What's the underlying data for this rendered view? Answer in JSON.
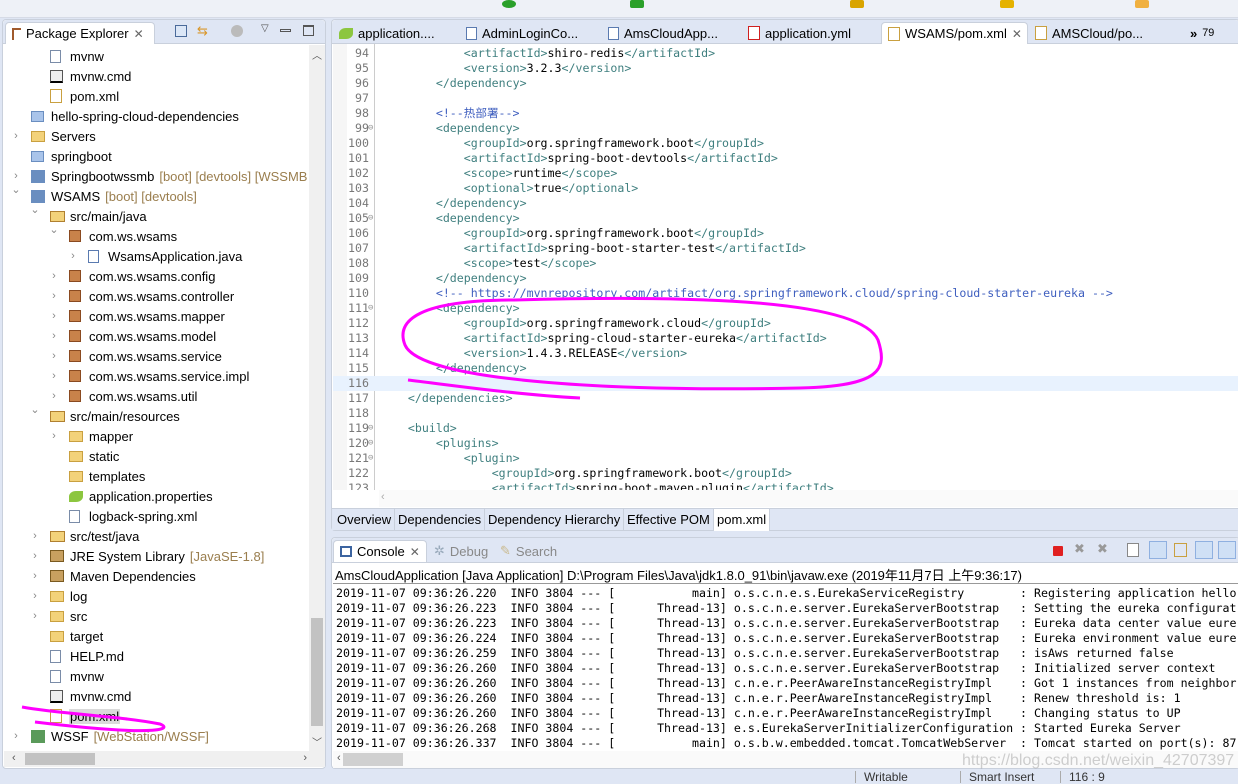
{
  "package_explorer": {
    "title": "Package Explorer",
    "tree": [
      {
        "level": 2,
        "label": "mvnw",
        "icon": "file-icon"
      },
      {
        "level": 2,
        "label": "mvnw.cmd",
        "icon": "cmd-file-icon"
      },
      {
        "level": 2,
        "label": "pom.xml",
        "icon": "maven-pom-icon"
      },
      {
        "level": 1,
        "label": "hello-spring-cloud-dependencies",
        "icon": "project-folder-icon"
      },
      {
        "level": 1,
        "label": "Servers",
        "icon": "folder-icon",
        "arrow": "closed"
      },
      {
        "level": 1,
        "label": "springboot",
        "icon": "project-folder-icon"
      },
      {
        "level": 1,
        "label": "Springbootwssmb",
        "decoration": "[boot] [devtools] [WSSMB",
        "icon": "spring-boot-project-icon",
        "arrow": "closed"
      },
      {
        "level": 1,
        "label": "WSAMS",
        "decoration": "[boot] [devtools]",
        "icon": "spring-boot-project-icon",
        "arrow": "open"
      },
      {
        "level": 2,
        "label": "src/main/java",
        "icon": "source-folder-icon",
        "arrow": "open"
      },
      {
        "level": 3,
        "label": "com.ws.wsams",
        "icon": "package-icon",
        "arrow": "open"
      },
      {
        "level": 4,
        "label": "WsamsApplication.java",
        "icon": "java-file-icon",
        "arrow": "closed"
      },
      {
        "level": 3,
        "label": "com.ws.wsams.config",
        "icon": "package-icon",
        "arrow": "closed"
      },
      {
        "level": 3,
        "label": "com.ws.wsams.controller",
        "icon": "package-icon",
        "arrow": "closed"
      },
      {
        "level": 3,
        "label": "com.ws.wsams.mapper",
        "icon": "package-icon",
        "arrow": "closed"
      },
      {
        "level": 3,
        "label": "com.ws.wsams.model",
        "icon": "package-icon",
        "arrow": "closed"
      },
      {
        "level": 3,
        "label": "com.ws.wsams.service",
        "icon": "package-icon",
        "arrow": "closed"
      },
      {
        "level": 3,
        "label": "com.ws.wsams.service.impl",
        "icon": "package-icon",
        "arrow": "closed"
      },
      {
        "level": 3,
        "label": "com.ws.wsams.util",
        "icon": "package-icon",
        "arrow": "closed"
      },
      {
        "level": 2,
        "label": "src/main/resources",
        "icon": "source-folder-icon",
        "arrow": "open"
      },
      {
        "level": 3,
        "label": "mapper",
        "icon": "folder-icon",
        "arrow": "closed"
      },
      {
        "level": 3,
        "label": "static",
        "icon": "folder-icon"
      },
      {
        "level": 3,
        "label": "templates",
        "icon": "folder-icon"
      },
      {
        "level": 3,
        "label": "application.properties",
        "icon": "spring-properties-icon"
      },
      {
        "level": 3,
        "label": "logback-spring.xml",
        "icon": "xml-file-icon"
      },
      {
        "level": 2,
        "label": "src/test/java",
        "icon": "source-folder-icon",
        "arrow": "closed"
      },
      {
        "level": 2,
        "label": "JRE System Library",
        "decoration": "[JavaSE-1.8]",
        "icon": "library-icon",
        "arrow": "closed"
      },
      {
        "level": 2,
        "label": "Maven Dependencies",
        "icon": "library-icon",
        "arrow": "closed"
      },
      {
        "level": 2,
        "label": "log",
        "icon": "folder-icon",
        "arrow": "closed"
      },
      {
        "level": 2,
        "label": "src",
        "icon": "folder-icon",
        "arrow": "closed"
      },
      {
        "level": 2,
        "label": "target",
        "icon": "folder-icon"
      },
      {
        "level": 2,
        "label": "HELP.md",
        "icon": "file-icon"
      },
      {
        "level": 2,
        "label": "mvnw",
        "icon": "file-icon"
      },
      {
        "level": 2,
        "label": "mvnw.cmd",
        "icon": "cmd-file-icon"
      },
      {
        "level": 2,
        "label": "pom.xml",
        "icon": "maven-pom-icon",
        "selected": true
      },
      {
        "level": 1,
        "label": "WSSF",
        "decoration": "[WebStation/WSSF]",
        "icon": "web-project-icon",
        "arrow": "closed"
      }
    ]
  },
  "editor": {
    "tabs": [
      {
        "label": "application....",
        "icon": "spring-properties-icon"
      },
      {
        "label": "AdminLoginCo...",
        "icon": "java-file-icon"
      },
      {
        "label": "AmsCloudApp...",
        "icon": "java-file-icon"
      },
      {
        "label": "application.yml",
        "icon": "yaml-file-icon"
      },
      {
        "label": "WSAMS/pom.xml",
        "icon": "maven-pom-icon",
        "active": true
      },
      {
        "label": "AMSCloud/po...",
        "icon": "maven-pom-icon"
      }
    ],
    "overflow_count": "79",
    "current_line": 116,
    "lines": [
      {
        "n": "94",
        "t": "            <artifactId>shiro-redis</artifactId>"
      },
      {
        "n": "95",
        "t": "            <version>3.2.3</version>"
      },
      {
        "n": "96",
        "t": "        </dependency>"
      },
      {
        "n": "97",
        "t": ""
      },
      {
        "n": "98",
        "t": "        <!--热部署-->"
      },
      {
        "n": "99",
        "t": "        <dependency>",
        "fold": true
      },
      {
        "n": "100",
        "t": "            <groupId>org.springframework.boot</groupId>"
      },
      {
        "n": "101",
        "t": "            <artifactId>spring-boot-devtools</artifactId>"
      },
      {
        "n": "102",
        "t": "            <scope>runtime</scope>"
      },
      {
        "n": "103",
        "t": "            <optional>true</optional>"
      },
      {
        "n": "104",
        "t": "        </dependency>"
      },
      {
        "n": "105",
        "t": "        <dependency>",
        "fold": true
      },
      {
        "n": "106",
        "t": "            <groupId>org.springframework.boot</groupId>"
      },
      {
        "n": "107",
        "t": "            <artifactId>spring-boot-starter-test</artifactId>"
      },
      {
        "n": "108",
        "t": "            <scope>test</scope>"
      },
      {
        "n": "109",
        "t": "        </dependency>"
      },
      {
        "n": "110",
        "t": "        <!-- https://mvnrepository.com/artifact/org.springframework.cloud/spring-cloud-starter-eureka -->"
      },
      {
        "n": "111",
        "t": "        <dependency>",
        "fold": true
      },
      {
        "n": "112",
        "t": "            <groupId>org.springframework.cloud</groupId>"
      },
      {
        "n": "113",
        "t": "            <artifactId>spring-cloud-starter-eureka</artifactId>"
      },
      {
        "n": "114",
        "t": "            <version>1.4.3.RELEASE</version>"
      },
      {
        "n": "115",
        "t": "        </dependency>"
      },
      {
        "n": "116",
        "t": ""
      },
      {
        "n": "117",
        "t": "    </dependencies>"
      },
      {
        "n": "118",
        "t": ""
      },
      {
        "n": "119",
        "t": "    <build>",
        "fold": true
      },
      {
        "n": "120",
        "t": "        <plugins>",
        "fold": true
      },
      {
        "n": "121",
        "t": "            <plugin>",
        "fold": true
      },
      {
        "n": "122",
        "t": "                <groupId>org.springframework.boot</groupId>"
      },
      {
        "n": "123",
        "t": "                <artifactId>spring-boot-maven-plugin</artifactId>"
      }
    ],
    "bottom_tabs": [
      "Overview",
      "Dependencies",
      "Dependency Hierarchy",
      "Effective POM",
      "pom.xml"
    ],
    "active_bottom_tab": 4
  },
  "console": {
    "tabs": [
      "Console",
      "Debug",
      "Search"
    ],
    "launch": "AmsCloudApplication [Java Application] D:\\Program Files\\Java\\jdk1.8.0_91\\bin\\javaw.exe (2019年11月7日 上午9:36:17)",
    "lines": [
      "2019-11-07 09:36:26.220  INFO 3804 --- [           main] o.s.c.n.e.s.EurekaServiceRegistry        : Registering application hello",
      "2019-11-07 09:36:26.223  INFO 3804 --- [      Thread-13] o.s.c.n.e.server.EurekaServerBootstrap   : Setting the eureka configurat",
      "2019-11-07 09:36:26.223  INFO 3804 --- [      Thread-13] o.s.c.n.e.server.EurekaServerBootstrap   : Eureka data center value eure",
      "2019-11-07 09:36:26.224  INFO 3804 --- [      Thread-13] o.s.c.n.e.server.EurekaServerBootstrap   : Eureka environment value eure",
      "2019-11-07 09:36:26.259  INFO 3804 --- [      Thread-13] o.s.c.n.e.server.EurekaServerBootstrap   : isAws returned false",
      "2019-11-07 09:36:26.260  INFO 3804 --- [      Thread-13] o.s.c.n.e.server.EurekaServerBootstrap   : Initialized server context",
      "2019-11-07 09:36:26.260  INFO 3804 --- [      Thread-13] c.n.e.r.PeerAwareInstanceRegistryImpl    : Got 1 instances from neighbor",
      "2019-11-07 09:36:26.260  INFO 3804 --- [      Thread-13] c.n.e.r.PeerAwareInstanceRegistryImpl    : Renew threshold is: 1",
      "2019-11-07 09:36:26.260  INFO 3804 --- [      Thread-13] c.n.e.r.PeerAwareInstanceRegistryImpl    : Changing status to UP",
      "2019-11-07 09:36:26.268  INFO 3804 --- [      Thread-13] e.s.EurekaServerInitializerConfiguration : Started Eureka Server",
      "2019-11-07 09:36:26.337  INFO 3804 --- [           main] o.s.b.w.embedded.tomcat.TomcatWebServer  : Tomcat started on port(s): 87"
    ]
  },
  "status_bar": {
    "mode": "Writable",
    "insert": "Smart Insert",
    "position": "116 : 9"
  },
  "watermark": "https://blog.csdn.net/weixin_42707397",
  "colors": {
    "tag": "#3f7f7f",
    "comment": "#3f5fbf",
    "annotation": "#ff00ff",
    "current_line": "#e8f2fe"
  }
}
